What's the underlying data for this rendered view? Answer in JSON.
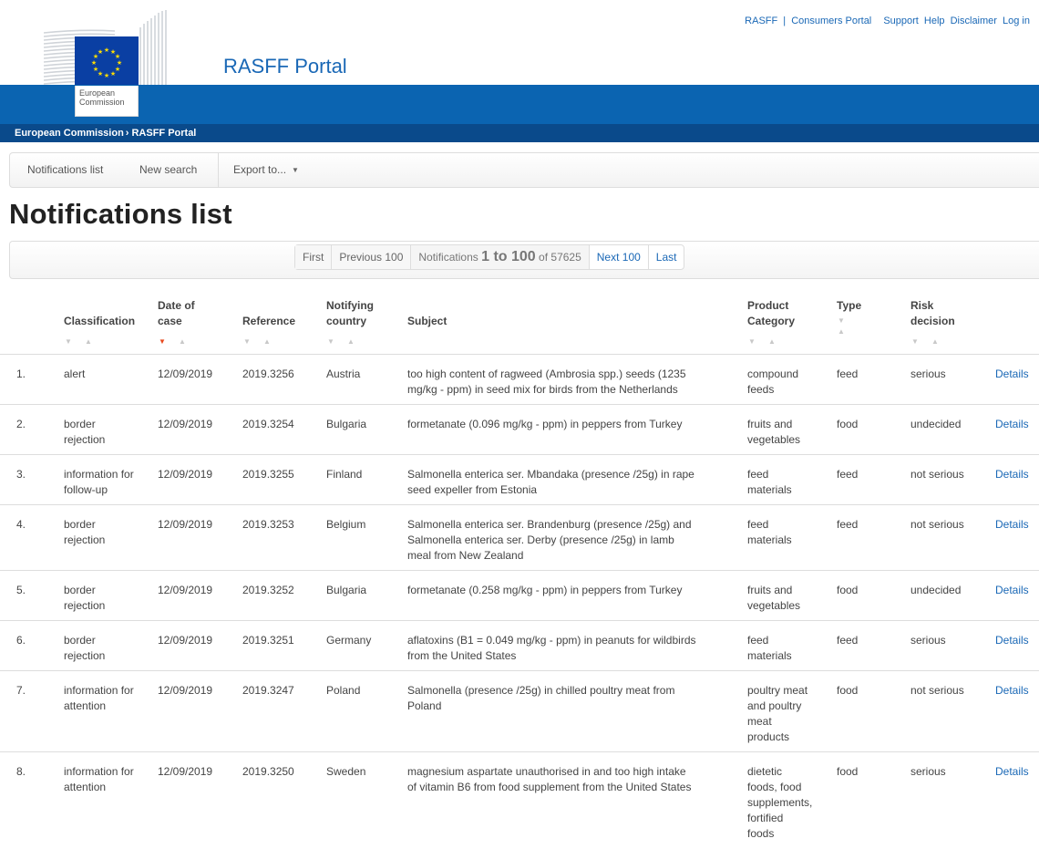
{
  "header": {
    "ec_logo_line1": "European",
    "ec_logo_line2": "Commission",
    "portal_title": "RASFF Portal",
    "top_links": {
      "rasff": "RASFF",
      "separator": "|",
      "consumers": "Consumers Portal",
      "support": "Support",
      "help": "Help",
      "disclaimer": "Disclaimer",
      "login": "Log in"
    },
    "breadcrumb": {
      "home": "European Commission",
      "separator": "›",
      "current": "RASFF Portal"
    }
  },
  "toolbar": {
    "notifications_list": "Notifications list",
    "new_search": "New search",
    "export_to": "Export to...",
    "caret": "▼"
  },
  "page_title": "Notifications list",
  "pager": {
    "first": "First",
    "previous": "Previous 100",
    "info_prefix": "Notifications",
    "info_range": "1 to 100",
    "info_of": "of",
    "info_total": "57625",
    "next": "Next 100",
    "last": "Last"
  },
  "table": {
    "sort_down": "▼",
    "sort_up": "▲",
    "headers": {
      "classification": "Classification",
      "date_line1": "Date of",
      "date_line2": "case",
      "reference": "Reference",
      "country_line1": "Notifying",
      "country_line2": "country",
      "subject": "Subject",
      "product_line1": "Product",
      "product_line2": "Category",
      "type": "Type",
      "risk_line1": "Risk",
      "risk_line2": "decision"
    },
    "rows": [
      {
        "num": "1.",
        "classification_1": "alert",
        "classification_2": "",
        "date": "12/09/2019",
        "reference": "2019.3256",
        "country": "Austria",
        "subject_1": "too high content of ragweed (Ambrosia spp.) seeds (1235",
        "subject_2": "mg/kg - ppm) in seed mix for birds from the Netherlands",
        "subject_3": "",
        "product_1": "compound",
        "product_2": "feeds",
        "product_3": "",
        "product_4": "",
        "product_5": "",
        "type": "feed",
        "risk": "serious",
        "details": "Details"
      },
      {
        "num": "2.",
        "classification_1": "border",
        "classification_2": "rejection",
        "date": "12/09/2019",
        "reference": "2019.3254",
        "country": "Bulgaria",
        "subject_1": "formetanate (0.096 mg/kg - ppm) in peppers from Turkey",
        "subject_2": "",
        "subject_3": "",
        "product_1": "fruits and",
        "product_2": "vegetables",
        "product_3": "",
        "product_4": "",
        "product_5": "",
        "type": "food",
        "risk": "undecided",
        "details": "Details"
      },
      {
        "num": "3.",
        "classification_1": "information for",
        "classification_2": "follow-up",
        "date": "12/09/2019",
        "reference": "2019.3255",
        "country": "Finland",
        "subject_1": "Salmonella enterica ser. Mbandaka (presence /25g) in rape",
        "subject_2": "seed expeller from Estonia",
        "subject_3": "",
        "product_1": "feed",
        "product_2": "materials",
        "product_3": "",
        "product_4": "",
        "product_5": "",
        "type": "feed",
        "risk": "not serious",
        "details": "Details"
      },
      {
        "num": "4.",
        "classification_1": "border",
        "classification_2": "rejection",
        "date": "12/09/2019",
        "reference": "2019.3253",
        "country": "Belgium",
        "subject_1": "Salmonella enterica ser. Brandenburg (presence /25g) and",
        "subject_2": "Salmonella enterica ser. Derby (presence /25g) in lamb",
        "subject_3": "meal from New Zealand",
        "product_1": "feed",
        "product_2": "materials",
        "product_3": "",
        "product_4": "",
        "product_5": "",
        "type": "feed",
        "risk": "not serious",
        "details": "Details"
      },
      {
        "num": "5.",
        "classification_1": "border",
        "classification_2": "rejection",
        "date": "12/09/2019",
        "reference": "2019.3252",
        "country": "Bulgaria",
        "subject_1": "formetanate (0.258 mg/kg - ppm) in peppers from Turkey",
        "subject_2": "",
        "subject_3": "",
        "product_1": "fruits and",
        "product_2": "vegetables",
        "product_3": "",
        "product_4": "",
        "product_5": "",
        "type": "food",
        "risk": "undecided",
        "details": "Details"
      },
      {
        "num": "6.",
        "classification_1": "border",
        "classification_2": "rejection",
        "date": "12/09/2019",
        "reference": "2019.3251",
        "country": "Germany",
        "subject_1": "aflatoxins (B1 = 0.049 mg/kg - ppm) in peanuts for wildbirds",
        "subject_2": "from the United States",
        "subject_3": "",
        "product_1": "feed",
        "product_2": "materials",
        "product_3": "",
        "product_4": "",
        "product_5": "",
        "type": "feed",
        "risk": "serious",
        "details": "Details"
      },
      {
        "num": "7.",
        "classification_1": "information for",
        "classification_2": "attention",
        "date": "12/09/2019",
        "reference": "2019.3247",
        "country": "Poland",
        "subject_1": "Salmonella (presence /25g) in chilled poultry meat from",
        "subject_2": "Poland",
        "subject_3": "",
        "product_1": "poultry meat",
        "product_2": "and poultry",
        "product_3": "meat",
        "product_4": "products",
        "product_5": "",
        "type": "food",
        "risk": "not serious",
        "details": "Details"
      },
      {
        "num": "8.",
        "classification_1": "information for",
        "classification_2": "attention",
        "date": "12/09/2019",
        "reference": "2019.3250",
        "country": "Sweden",
        "subject_1": "magnesium aspartate unauthorised in and too high intake",
        "subject_2": "of vitamin B6 from food supplement from the United States",
        "subject_3": "",
        "product_1": "dietetic",
        "product_2": "foods, food",
        "product_3": "supplements,",
        "product_4": "fortified",
        "product_5": "foods",
        "type": "food",
        "risk": "serious",
        "details": "Details"
      }
    ]
  }
}
